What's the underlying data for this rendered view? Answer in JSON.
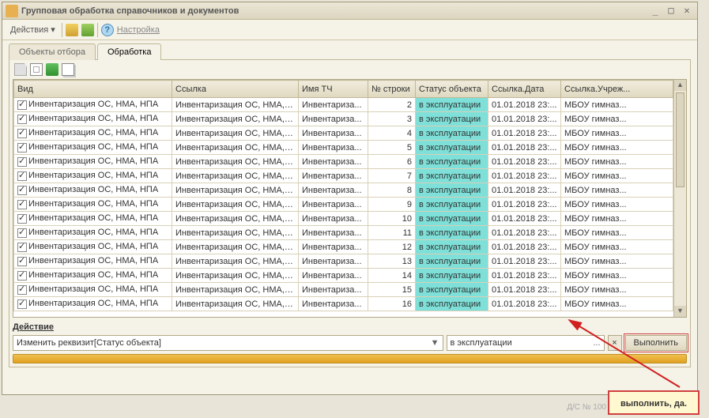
{
  "window": {
    "title": "Групповая обработка справочников и документов"
  },
  "toolbar": {
    "actions_label": "Действия ▾",
    "settings_label": "Настройка"
  },
  "tabs": [
    {
      "label": "Объекты отбора",
      "active": false
    },
    {
      "label": "Обработка",
      "active": true
    }
  ],
  "columns": {
    "vid": "Вид",
    "ssylka": "Ссылка",
    "imya_tch": "Имя ТЧ",
    "n_stroki": "№ строки",
    "status": "Статус объекта",
    "data": "Ссылка.Дата",
    "uchrezh": "Ссылка.Учреж..."
  },
  "rows": [
    {
      "checked": true,
      "vid": "Инвентаризация ОС, НМА, НПА",
      "ssylka": "Инвентаризация ОС, НМА, НП...",
      "tch": "Инвентариза...",
      "n": 2,
      "status": "в эксплуатации",
      "data": "01.01.2018 23:...",
      "uch": "МБОУ гимназ..."
    },
    {
      "checked": true,
      "vid": "Инвентаризация ОС, НМА, НПА",
      "ssylka": "Инвентаризация ОС, НМА, НП...",
      "tch": "Инвентариза...",
      "n": 3,
      "status": "в эксплуатации",
      "data": "01.01.2018 23:...",
      "uch": "МБОУ гимназ..."
    },
    {
      "checked": true,
      "vid": "Инвентаризация ОС, НМА, НПА",
      "ssylka": "Инвентаризация ОС, НМА, НП...",
      "tch": "Инвентариза...",
      "n": 4,
      "status": "в эксплуатации",
      "data": "01.01.2018 23:...",
      "uch": "МБОУ гимназ..."
    },
    {
      "checked": true,
      "vid": "Инвентаризация ОС, НМА, НПА",
      "ssylka": "Инвентаризация ОС, НМА, НП...",
      "tch": "Инвентариза...",
      "n": 5,
      "status": "в эксплуатации",
      "data": "01.01.2018 23:...",
      "uch": "МБОУ гимназ..."
    },
    {
      "checked": true,
      "vid": "Инвентаризация ОС, НМА, НПА",
      "ssylka": "Инвентаризация ОС, НМА, НП...",
      "tch": "Инвентариза...",
      "n": 6,
      "status": "в эксплуатации",
      "data": "01.01.2018 23:...",
      "uch": "МБОУ гимназ..."
    },
    {
      "checked": true,
      "vid": "Инвентаризация ОС, НМА, НПА",
      "ssylka": "Инвентаризация ОС, НМА, НП...",
      "tch": "Инвентариза...",
      "n": 7,
      "status": "в эксплуатации",
      "data": "01.01.2018 23:...",
      "uch": "МБОУ гимназ..."
    },
    {
      "checked": true,
      "vid": "Инвентаризация ОС, НМА, НПА",
      "ssylka": "Инвентаризация ОС, НМА, НП...",
      "tch": "Инвентариза...",
      "n": 8,
      "status": "в эксплуатации",
      "data": "01.01.2018 23:...",
      "uch": "МБОУ гимназ..."
    },
    {
      "checked": true,
      "vid": "Инвентаризация ОС, НМА, НПА",
      "ssylka": "Инвентаризация ОС, НМА, НП...",
      "tch": "Инвентариза...",
      "n": 9,
      "status": "в эксплуатации",
      "data": "01.01.2018 23:...",
      "uch": "МБОУ гимназ..."
    },
    {
      "checked": true,
      "vid": "Инвентаризация ОС, НМА, НПА",
      "ssylka": "Инвентаризация ОС, НМА, НП...",
      "tch": "Инвентариза...",
      "n": 10,
      "status": "в эксплуатации",
      "data": "01.01.2018 23:...",
      "uch": "МБОУ гимназ..."
    },
    {
      "checked": true,
      "vid": "Инвентаризация ОС, НМА, НПА",
      "ssylka": "Инвентаризация ОС, НМА, НП...",
      "tch": "Инвентариза...",
      "n": 11,
      "status": "в эксплуатации",
      "data": "01.01.2018 23:...",
      "uch": "МБОУ гимназ..."
    },
    {
      "checked": true,
      "vid": "Инвентаризация ОС, НМА, НПА",
      "ssylka": "Инвентаризация ОС, НМА, НП...",
      "tch": "Инвентариза...",
      "n": 12,
      "status": "в эксплуатации",
      "data": "01.01.2018 23:...",
      "uch": "МБОУ гимназ..."
    },
    {
      "checked": true,
      "vid": "Инвентаризация ОС, НМА, НПА",
      "ssylka": "Инвентаризация ОС, НМА, НП...",
      "tch": "Инвентариза...",
      "n": 13,
      "status": "в эксплуатации",
      "data": "01.01.2018 23:...",
      "uch": "МБОУ гимназ..."
    },
    {
      "checked": true,
      "vid": "Инвентаризация ОС, НМА, НПА",
      "ssylka": "Инвентаризация ОС, НМА, НП...",
      "tch": "Инвентариза...",
      "n": 14,
      "status": "в эксплуатации",
      "data": "01.01.2018 23:...",
      "uch": "МБОУ гимназ..."
    },
    {
      "checked": true,
      "vid": "Инвентаризация ОС, НМА, НПА",
      "ssylka": "Инвентаризация ОС, НМА, НП...",
      "tch": "Инвентариза...",
      "n": 15,
      "status": "в эксплуатации",
      "data": "01.01.2018 23:...",
      "uch": "МБОУ гимназ..."
    },
    {
      "checked": true,
      "vid": "Инвентаризация ОС, НМА, НПА",
      "ssylka": "Инвентаризация ОС, НМА, НП...",
      "tch": "Инвентариза...",
      "n": 16,
      "status": "в эксплуатации",
      "data": "01.01.2018 23:...",
      "uch": "МБОУ гимназ..."
    }
  ],
  "action": {
    "section_label": "Действие",
    "select_value": "Изменить реквизит[Статус объекта]",
    "value_input": "в эксплуатации",
    "execute_label": "Выполнить",
    "x_label": "×",
    "dots_label": "...",
    "arrow_label": "▼"
  },
  "hint": {
    "text": "выполнить, да."
  },
  "bottom_status": "Д/С № 100"
}
